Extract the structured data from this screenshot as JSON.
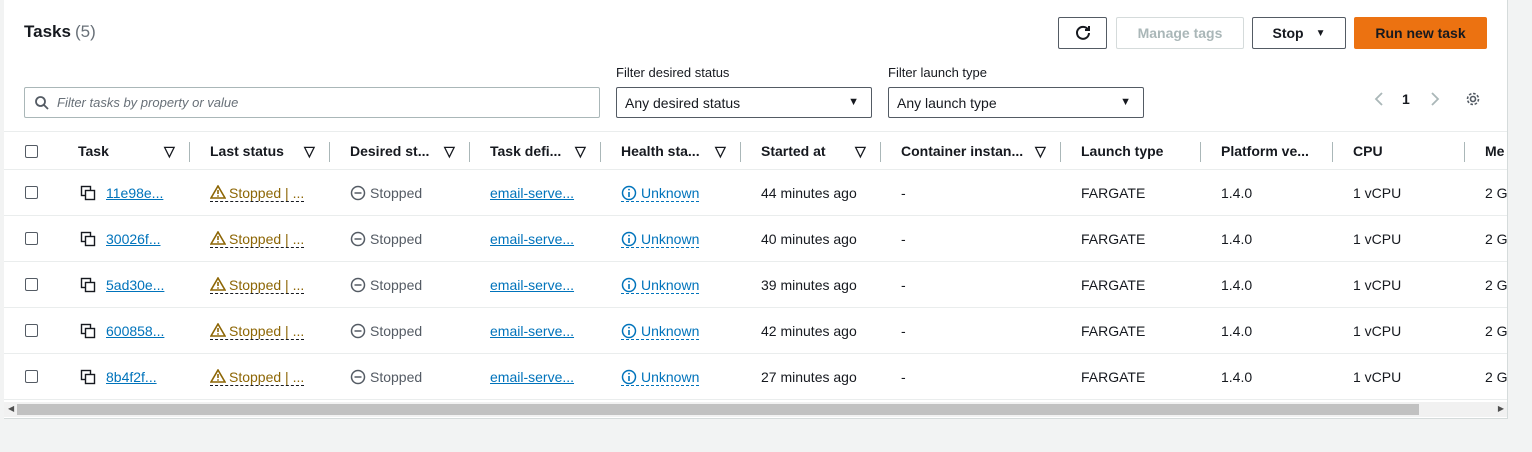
{
  "header": {
    "title": "Tasks",
    "count": "(5)"
  },
  "toolbar": {
    "refresh_icon": "refresh-icon",
    "manage_tags": "Manage tags",
    "stop": "Stop",
    "run_new_task": "Run new task"
  },
  "search": {
    "placeholder": "Filter tasks by property or value"
  },
  "filters": {
    "desired_status": {
      "label": "Filter desired status",
      "value": "Any desired status"
    },
    "launch_type": {
      "label": "Filter launch type",
      "value": "Any launch type"
    }
  },
  "pagination": {
    "page": "1"
  },
  "columns": [
    "Task",
    "Last status",
    "Desired st...",
    "Task defi...",
    "Health sta...",
    "Started at",
    "Container instan...",
    "Launch type",
    "Platform ve...",
    "CPU",
    "Me"
  ],
  "rows": [
    {
      "task": "11e98e...",
      "last_status": "Stopped | ...",
      "desired": "Stopped",
      "task_def": "email-serve...",
      "health": "Unknown",
      "started": "44 minutes ago",
      "container": "-",
      "launch": "FARGATE",
      "platform": "1.4.0",
      "cpu": "1 vCPU",
      "mem": "2 G"
    },
    {
      "task": "30026f...",
      "last_status": "Stopped | ...",
      "desired": "Stopped",
      "task_def": "email-serve...",
      "health": "Unknown",
      "started": "40 minutes ago",
      "container": "-",
      "launch": "FARGATE",
      "platform": "1.4.0",
      "cpu": "1 vCPU",
      "mem": "2 G"
    },
    {
      "task": "5ad30e...",
      "last_status": "Stopped | ...",
      "desired": "Stopped",
      "task_def": "email-serve...",
      "health": "Unknown",
      "started": "39 minutes ago",
      "container": "-",
      "launch": "FARGATE",
      "platform": "1.4.0",
      "cpu": "1 vCPU",
      "mem": "2 G"
    },
    {
      "task": "600858...",
      "last_status": "Stopped | ...",
      "desired": "Stopped",
      "task_def": "email-serve...",
      "health": "Unknown",
      "started": "42 minutes ago",
      "container": "-",
      "launch": "FARGATE",
      "platform": "1.4.0",
      "cpu": "1 vCPU",
      "mem": "2 G"
    },
    {
      "task": "8b4f2f...",
      "last_status": "Stopped | ...",
      "desired": "Stopped",
      "task_def": "email-serve...",
      "health": "Unknown",
      "started": "27 minutes ago",
      "container": "-",
      "launch": "FARGATE",
      "platform": "1.4.0",
      "cpu": "1 vCPU",
      "mem": "2 G"
    }
  ],
  "colors": {
    "accent": "#ec7211",
    "link": "#0073bb",
    "warning": "#8d6605",
    "text": "#16191f"
  }
}
